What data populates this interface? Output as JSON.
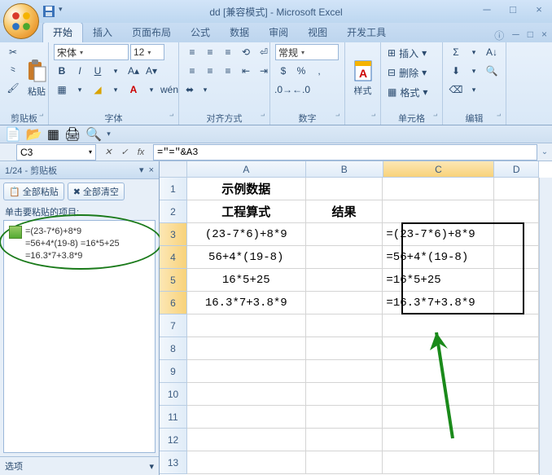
{
  "app": {
    "title": "dd  [兼容模式] - Microsoft Excel"
  },
  "tabs": [
    "开始",
    "插入",
    "页面布局",
    "公式",
    "数据",
    "审阅",
    "视图",
    "开发工具"
  ],
  "active_tab": 0,
  "ribbon": {
    "clipboard": {
      "label": "剪贴板",
      "paste": "粘贴"
    },
    "font": {
      "label": "字体",
      "name": "宋体",
      "size": "12"
    },
    "align": {
      "label": "对齐方式"
    },
    "number": {
      "label": "数字",
      "format": "常规"
    },
    "styles": {
      "label": "",
      "btn": "样式"
    },
    "cells": {
      "label": "单元格",
      "insert": "插入",
      "delete": "删除",
      "format": "格式"
    },
    "editing": {
      "label": "编辑"
    }
  },
  "namebox": "C3",
  "formula": "=\"=\"&A3",
  "clipboard_pane": {
    "title": "1/24 - 剪贴板",
    "paste_all": "全部粘贴",
    "clear_all": "全部清空",
    "hint": "单击要粘贴的项目:",
    "item_lines": [
      "=(23-7*6)+8*9",
      "=56+4*(19-8) =16*5+25",
      "=16.3*7+3.8*9"
    ],
    "options": "选项"
  },
  "columns": [
    "A",
    "B",
    "C",
    "D"
  ],
  "col_widths": {
    "A": 160,
    "B": 104,
    "C": 150,
    "D": 60
  },
  "row_count": 13,
  "highlight_rows": [
    3,
    4,
    5,
    6
  ],
  "selection": {
    "col": "C",
    "row_start": 3,
    "row_end": 6
  },
  "cells": {
    "A1": "示例数据",
    "A2": "工程算式",
    "B2": "结果",
    "A3": "(23-7*6)+8*9",
    "A4": "56+4*(19-8)",
    "A5": "16*5+25",
    "A6": "16.3*7+3.8*9",
    "C3": "=(23-7*6)+8*9",
    "C4": "=56+4*(19-8)",
    "C5": "=16*5+25",
    "C6": "=16.3*7+3.8*9"
  },
  "colors": {
    "accent": "#3b73b9",
    "highlight": "#f8d27a"
  }
}
